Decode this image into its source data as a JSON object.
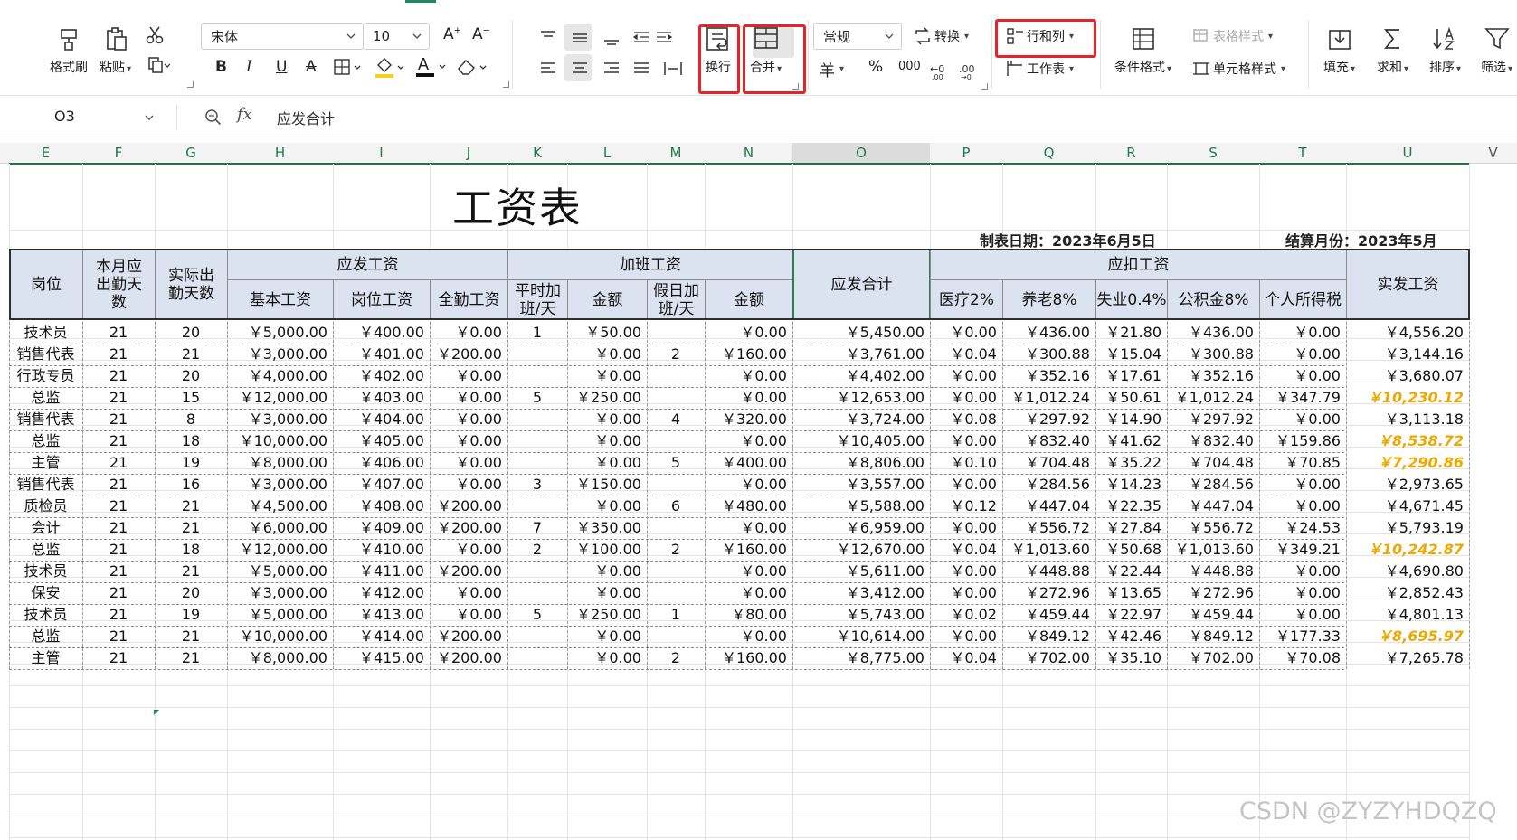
{
  "ribbon": {
    "format_painter": "格式刷",
    "paste": "粘贴",
    "font_name": "宋体",
    "font_size": "10",
    "wrap_text": "换行",
    "merge": "合并",
    "number_format": "常规",
    "convert": "转换",
    "rows_cols": "行和列",
    "worksheet": "工作表",
    "cond_format": "条件格式",
    "table_style": "表格样式",
    "cell_style": "单元格样式",
    "fill": "填充",
    "sum": "求和",
    "sort": "排序",
    "filter": "筛选",
    "currency_symbol": "羊",
    "percent_symbol": "%",
    "thousands_symbol": "000"
  },
  "formula_bar": {
    "cell_ref": "O3",
    "fx": "fx",
    "content": "应发合计"
  },
  "columns": [
    "E",
    "F",
    "G",
    "H",
    "I",
    "J",
    "K",
    "L",
    "M",
    "N",
    "O",
    "P",
    "Q",
    "R",
    "S",
    "T",
    "U",
    "V"
  ],
  "sheet": {
    "title": "工资表",
    "made_date": "制表日期：2023年6月5日",
    "settle_month": "结算月份：2023年5月"
  },
  "headers": {
    "position": "岗位",
    "days_due": "本月应出勤天数",
    "days_actual": "实际出勤天数",
    "payable_group": "应发工资",
    "base_salary": "基本工资",
    "post_salary": "岗位工资",
    "attendance_bonus": "全勤工资",
    "overtime_group": "加班工资",
    "weekday_ot": "平时加班/天",
    "weekday_amount": "金额",
    "holiday_ot": "假日加班/天",
    "holiday_amount": "金额",
    "payable_total": "应发合计",
    "deduct_group": "应扣工资",
    "medical": "医疗2%",
    "pension": "养老8%",
    "unemployment": "失业0.4%",
    "housing_fund": "公积金8%",
    "income_tax": "个人所得税",
    "net_pay": "实发工资"
  },
  "rows": [
    [
      "技术员",
      "21",
      "20",
      "￥5,000.00",
      "￥400.00",
      "￥0.00",
      "1",
      "￥50.00",
      "",
      "￥0.00",
      "￥5,450.00",
      "￥0.00",
      "￥436.00",
      "￥21.80",
      "￥436.00",
      "￥0.00",
      "￥4,556.20"
    ],
    [
      "销售代表",
      "21",
      "21",
      "￥3,000.00",
      "￥401.00",
      "￥200.00",
      "",
      "￥0.00",
      "2",
      "￥160.00",
      "￥3,761.00",
      "￥0.04",
      "￥300.88",
      "￥15.04",
      "￥300.88",
      "￥0.00",
      "￥3,144.16"
    ],
    [
      "行政专员",
      "21",
      "20",
      "￥4,000.00",
      "￥402.00",
      "￥0.00",
      "",
      "￥0.00",
      "",
      "￥0.00",
      "￥4,402.00",
      "￥0.00",
      "￥352.16",
      "￥17.61",
      "￥352.16",
      "￥0.00",
      "￥3,680.07"
    ],
    [
      "总监",
      "21",
      "15",
      "￥12,000.00",
      "￥403.00",
      "￥0.00",
      "5",
      "￥250.00",
      "",
      "￥0.00",
      "￥12,653.00",
      "￥0.00",
      "￥1,012.24",
      "￥50.61",
      "￥1,012.24",
      "￥347.79",
      "￥10,230.12"
    ],
    [
      "销售代表",
      "21",
      "8",
      "￥3,000.00",
      "￥404.00",
      "￥0.00",
      "",
      "￥0.00",
      "4",
      "￥320.00",
      "￥3,724.00",
      "￥0.08",
      "￥297.92",
      "￥14.90",
      "￥297.92",
      "￥0.00",
      "￥3,113.18"
    ],
    [
      "总监",
      "21",
      "18",
      "￥10,000.00",
      "￥405.00",
      "￥0.00",
      "",
      "￥0.00",
      "",
      "￥0.00",
      "￥10,405.00",
      "￥0.00",
      "￥832.40",
      "￥41.62",
      "￥832.40",
      "￥159.86",
      "￥8,538.72"
    ],
    [
      "主管",
      "21",
      "19",
      "￥8,000.00",
      "￥406.00",
      "￥0.00",
      "",
      "￥0.00",
      "5",
      "￥400.00",
      "￥8,806.00",
      "￥0.10",
      "￥704.48",
      "￥35.22",
      "￥704.48",
      "￥70.85",
      "￥7,290.86"
    ],
    [
      "销售代表",
      "21",
      "16",
      "￥3,000.00",
      "￥407.00",
      "￥0.00",
      "3",
      "￥150.00",
      "",
      "￥0.00",
      "￥3,557.00",
      "￥0.00",
      "￥284.56",
      "￥14.23",
      "￥284.56",
      "￥0.00",
      "￥2,973.65"
    ],
    [
      "质检员",
      "21",
      "21",
      "￥4,500.00",
      "￥408.00",
      "￥200.00",
      "",
      "￥0.00",
      "6",
      "￥480.00",
      "￥5,588.00",
      "￥0.12",
      "￥447.04",
      "￥22.35",
      "￥447.04",
      "￥0.00",
      "￥4,671.45"
    ],
    [
      "会计",
      "21",
      "21",
      "￥6,000.00",
      "￥409.00",
      "￥200.00",
      "7",
      "￥350.00",
      "",
      "￥0.00",
      "￥6,959.00",
      "￥0.00",
      "￥556.72",
      "￥27.84",
      "￥556.72",
      "￥24.53",
      "￥5,793.19"
    ],
    [
      "总监",
      "21",
      "18",
      "￥12,000.00",
      "￥410.00",
      "￥0.00",
      "2",
      "￥100.00",
      "2",
      "￥160.00",
      "￥12,670.00",
      "￥0.04",
      "￥1,013.60",
      "￥50.68",
      "￥1,013.60",
      "￥349.21",
      "￥10,242.87"
    ],
    [
      "技术员",
      "21",
      "21",
      "￥5,000.00",
      "￥411.00",
      "￥200.00",
      "",
      "￥0.00",
      "",
      "￥0.00",
      "￥5,611.00",
      "￥0.00",
      "￥448.88",
      "￥22.44",
      "￥448.88",
      "￥0.00",
      "￥4,690.80"
    ],
    [
      "保安",
      "21",
      "20",
      "￥3,000.00",
      "￥412.00",
      "￥0.00",
      "",
      "￥0.00",
      "",
      "￥0.00",
      "￥3,412.00",
      "￥0.00",
      "￥272.96",
      "￥13.65",
      "￥272.96",
      "￥0.00",
      "￥2,852.43"
    ],
    [
      "技术员",
      "21",
      "19",
      "￥5,000.00",
      "￥413.00",
      "￥0.00",
      "5",
      "￥250.00",
      "1",
      "￥80.00",
      "￥5,743.00",
      "￥0.02",
      "￥459.44",
      "￥22.97",
      "￥459.44",
      "￥0.00",
      "￥4,801.13"
    ],
    [
      "总监",
      "21",
      "21",
      "￥10,000.00",
      "￥414.00",
      "￥200.00",
      "",
      "￥0.00",
      "",
      "￥0.00",
      "￥10,614.00",
      "￥0.00",
      "￥849.12",
      "￥42.46",
      "￥849.12",
      "￥177.33",
      "￥8,695.97"
    ],
    [
      "主管",
      "21",
      "21",
      "￥8,000.00",
      "￥415.00",
      "￥200.00",
      "",
      "￥0.00",
      "2",
      "￥160.00",
      "￥8,775.00",
      "￥0.04",
      "￥702.00",
      "￥35.10",
      "￥702.00",
      "￥70.08",
      "￥7,265.78"
    ]
  ],
  "highlight_rows": [
    3,
    5,
    6,
    10,
    14
  ],
  "colors": {
    "header_fill": "#dce3f0",
    "highlight_text": "#f0a800",
    "callout_box": "#e8222a",
    "table_accent": "#217346"
  },
  "watermark": "CSDN @ZYZYHDQZQ"
}
